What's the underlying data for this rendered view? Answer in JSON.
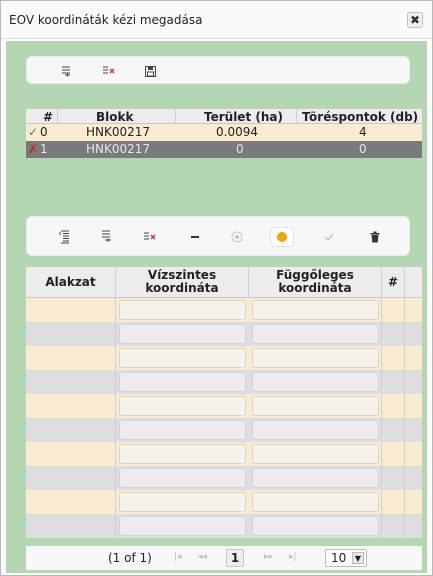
{
  "window": {
    "title": "EOV koordináták kézi megadása",
    "close_glyph": "✖"
  },
  "toolbar1": {
    "buttons": [
      {
        "name": "row-insert-icon",
        "glyph": "≡̲"
      },
      {
        "name": "row-delete-icon",
        "glyph": "⇥×"
      },
      {
        "name": "save-icon",
        "glyph": "🖫"
      }
    ]
  },
  "blocks_table": {
    "headers": [
      "#",
      "Blokk",
      "Terület (ha)",
      "Töréspontok (db)"
    ],
    "rows": [
      {
        "status": "✓",
        "index": "0",
        "block": "HNK00217",
        "area": "0.0094",
        "points": "4"
      },
      {
        "status": "✗",
        "index": "1",
        "block": "HNK00217",
        "area": "0",
        "points": "0"
      }
    ]
  },
  "toolbar2": {
    "glyphs": {
      "insert_above": "≡↑",
      "insert_below": "≡↓",
      "delete_row": "⇥×",
      "minus": "−",
      "radio": "◎",
      "dot": "●",
      "check": "✓",
      "trash": "🗑"
    }
  },
  "coords_table": {
    "headers": {
      "shape": "Alakzat",
      "x": "Vízszintes koordináta",
      "y": "Függőleges koordináta",
      "num": "#"
    },
    "row_count": 10
  },
  "pager": {
    "info": "(1 of 1)",
    "first": "|◂",
    "prev": "◂◂",
    "current": "1",
    "next": "▸▸",
    "last": "▸|",
    "per_page": "10",
    "per_page_arrow": "▼"
  },
  "colors": {
    "panel_green": "#b5d6b2",
    "row_cream": "#f9ebd0",
    "row_grey": "#dedede",
    "selected_dark": "#7a7a7a",
    "accent_orange": "#f5a300"
  }
}
